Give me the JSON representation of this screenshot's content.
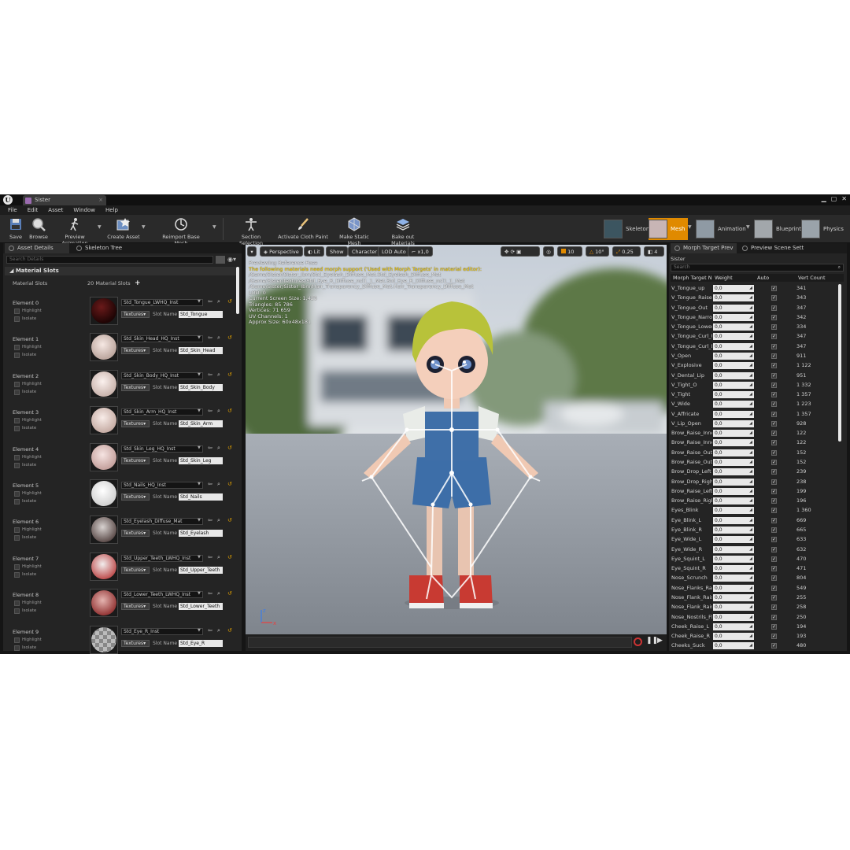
{
  "window": {
    "tab": "Sister",
    "logo": "U"
  },
  "menu": [
    "File",
    "Edit",
    "Asset",
    "Window",
    "Help"
  ],
  "toolbar": {
    "buttons": [
      "Save",
      "Browse",
      "Preview Animation",
      "Create Asset",
      "Reimport Base Mesh",
      "Section Selection",
      "Activate Cloth Paint",
      "Make Static Mesh",
      "Bake out Materials"
    ],
    "modes": [
      "Skeleton",
      "Mesh",
      "Animation",
      "Blueprint",
      "Physics"
    ]
  },
  "left": {
    "tabs": [
      "Asset Details",
      "Skeleton Tree"
    ],
    "search_placeholder": "Search Details",
    "category": "Material Slots",
    "slots_label": "Material Slots",
    "slots_count": "20 Material Slots",
    "highlight": "Highlight",
    "isolate": "Isolate",
    "textures": "Textures",
    "slot_name_label": "Slot Name",
    "elements": [
      {
        "name": "Element 0",
        "material": "Std_Tongue_LWHQ_Inst",
        "slot": "Std_Tongue"
      },
      {
        "name": "Element 1",
        "material": "Std_Skin_Head_HQ_Inst",
        "slot": "Std_Skin_Head"
      },
      {
        "name": "Element 2",
        "material": "Std_Skin_Body_HQ_Inst",
        "slot": "Std_Skin_Body"
      },
      {
        "name": "Element 3",
        "material": "Std_Skin_Arm_HQ_Inst",
        "slot": "Std_Skin_Arm"
      },
      {
        "name": "Element 4",
        "material": "Std_Skin_Leg_HQ_Inst",
        "slot": "Std_Skin_Leg"
      },
      {
        "name": "Element 5",
        "material": "Std_Nails_HQ_Inst",
        "slot": "Std_Nails"
      },
      {
        "name": "Element 6",
        "material": "Std_Eyelash_Diffuse_Mat",
        "slot": "Std_Eyelash"
      },
      {
        "name": "Element 7",
        "material": "Std_Upper_Teeth_LWHQ_Inst",
        "slot": "Std_Upper_Teeth"
      },
      {
        "name": "Element 8",
        "material": "Std_Lower_Teeth_LWHQ_Inst",
        "slot": "Std_Lower_Teeth"
      },
      {
        "name": "Element 9",
        "material": "Std_Eye_R_Inst",
        "slot": "Std_Eye_R"
      }
    ]
  },
  "viewport": {
    "perspective": "Perspective",
    "lit": "Lit",
    "show": "Show",
    "character": "Character",
    "lod": "LOD Auto",
    "speed": "x1,0",
    "grid": "10",
    "angle": "10°",
    "scale": "0,25",
    "cam": "4",
    "info": {
      "line1": "Previewing Reference Pose",
      "warn": "The following materials need morph support ('Used with Morph Targets' in material editor):",
      "path1": "/Game/Sister/Sister_Ibm/Std_Eyelash_Diffuse_Mat.Std_Eyelash_Diffuse_Mat",
      "path2": "/Game/Sister/textures/Std_Eye_R_Diffuse_ncl1_1_Mat.Std_Eye_R_Diffuse_ncl1_1_Mat",
      "path3": "/Game/Sister/Sister_Ibm/Hair_Transparency_Diffuse_Mat.Hair_Transparency_Diffuse_Mat",
      "lod": "LOD: 0",
      "screen": "Current Screen Size: 1,425",
      "tris": "Triangles: 85 786",
      "verts": "Vertices: 71 659",
      "uv": "UV Channels: 1",
      "size": "Approx Size: 60x48x181"
    }
  },
  "right": {
    "tabs": [
      "Morph Target Prev",
      "Preview Scene Sett"
    ],
    "title": "Sister",
    "search_placeholder": "Search",
    "columns": [
      "Morph Target N",
      "Weight",
      "Auto",
      "Vert Count"
    ],
    "morphs": [
      [
        "V_Tongue_up",
        "0,0",
        "341"
      ],
      [
        "V_Tongue_Raise",
        "0,0",
        "343"
      ],
      [
        "V_Tongue_Out",
        "0,0",
        "347"
      ],
      [
        "V_Tongue_Narrow",
        "0,0",
        "342"
      ],
      [
        "V_Tongue_Lower",
        "0,0",
        "334"
      ],
      [
        "V_Tongue_Curl_U",
        "0,0",
        "347"
      ],
      [
        "V_Tongue_Curl_D",
        "0,0",
        "347"
      ],
      [
        "V_Open",
        "0,0",
        "911"
      ],
      [
        "V_Explosive",
        "0,0",
        "1 122"
      ],
      [
        "V_Dental_Lip",
        "0,0",
        "951"
      ],
      [
        "V_Tight_O",
        "0,0",
        "1 332"
      ],
      [
        "V_Tight",
        "0,0",
        "1 357"
      ],
      [
        "V_Wide",
        "0,0",
        "1 223"
      ],
      [
        "V_Affricate",
        "0,0",
        "1 357"
      ],
      [
        "V_Lip_Open",
        "0,0",
        "928"
      ],
      [
        "Brow_Raise_Inner",
        "0,0",
        "122"
      ],
      [
        "Brow_Raise_Inner",
        "0,0",
        "122"
      ],
      [
        "Brow_Raise_Outer",
        "0,0",
        "152"
      ],
      [
        "Brow_Raise_Outer",
        "0,0",
        "152"
      ],
      [
        "Brow_Drop_Left",
        "0,0",
        "239"
      ],
      [
        "Brow_Drop_Right",
        "0,0",
        "238"
      ],
      [
        "Brow_Raise_Left",
        "0,0",
        "199"
      ],
      [
        "Brow_Raise_Right",
        "0,0",
        "196"
      ],
      [
        "Eyes_Blink",
        "0,0",
        "1 360"
      ],
      [
        "Eye_Blink_L",
        "0,0",
        "669"
      ],
      [
        "Eye_Blink_R",
        "0,0",
        "665"
      ],
      [
        "Eye_Wide_L",
        "0,0",
        "633"
      ],
      [
        "Eye_Wide_R",
        "0,0",
        "632"
      ],
      [
        "Eye_Squint_L",
        "0,0",
        "470"
      ],
      [
        "Eye_Squint_R",
        "0,0",
        "471"
      ],
      [
        "Nose_Scrunch",
        "0,0",
        "804"
      ],
      [
        "Nose_Flanks_Raise",
        "0,0",
        "549"
      ],
      [
        "Nose_Flank_Raise",
        "0,0",
        "255"
      ],
      [
        "Nose_Flank_Raise",
        "0,0",
        "258"
      ],
      [
        "Nose_Nostrils_Flare",
        "0,0",
        "250"
      ],
      [
        "Cheek_Raise_L",
        "0,0",
        "194"
      ],
      [
        "Cheek_Raise_R",
        "0,0",
        "193"
      ],
      [
        "Cheeks_Suck",
        "0,0",
        "480"
      ]
    ]
  },
  "colors": {
    "accent": "#e08a00",
    "warn": "#ffd400",
    "panel": "#242424"
  }
}
